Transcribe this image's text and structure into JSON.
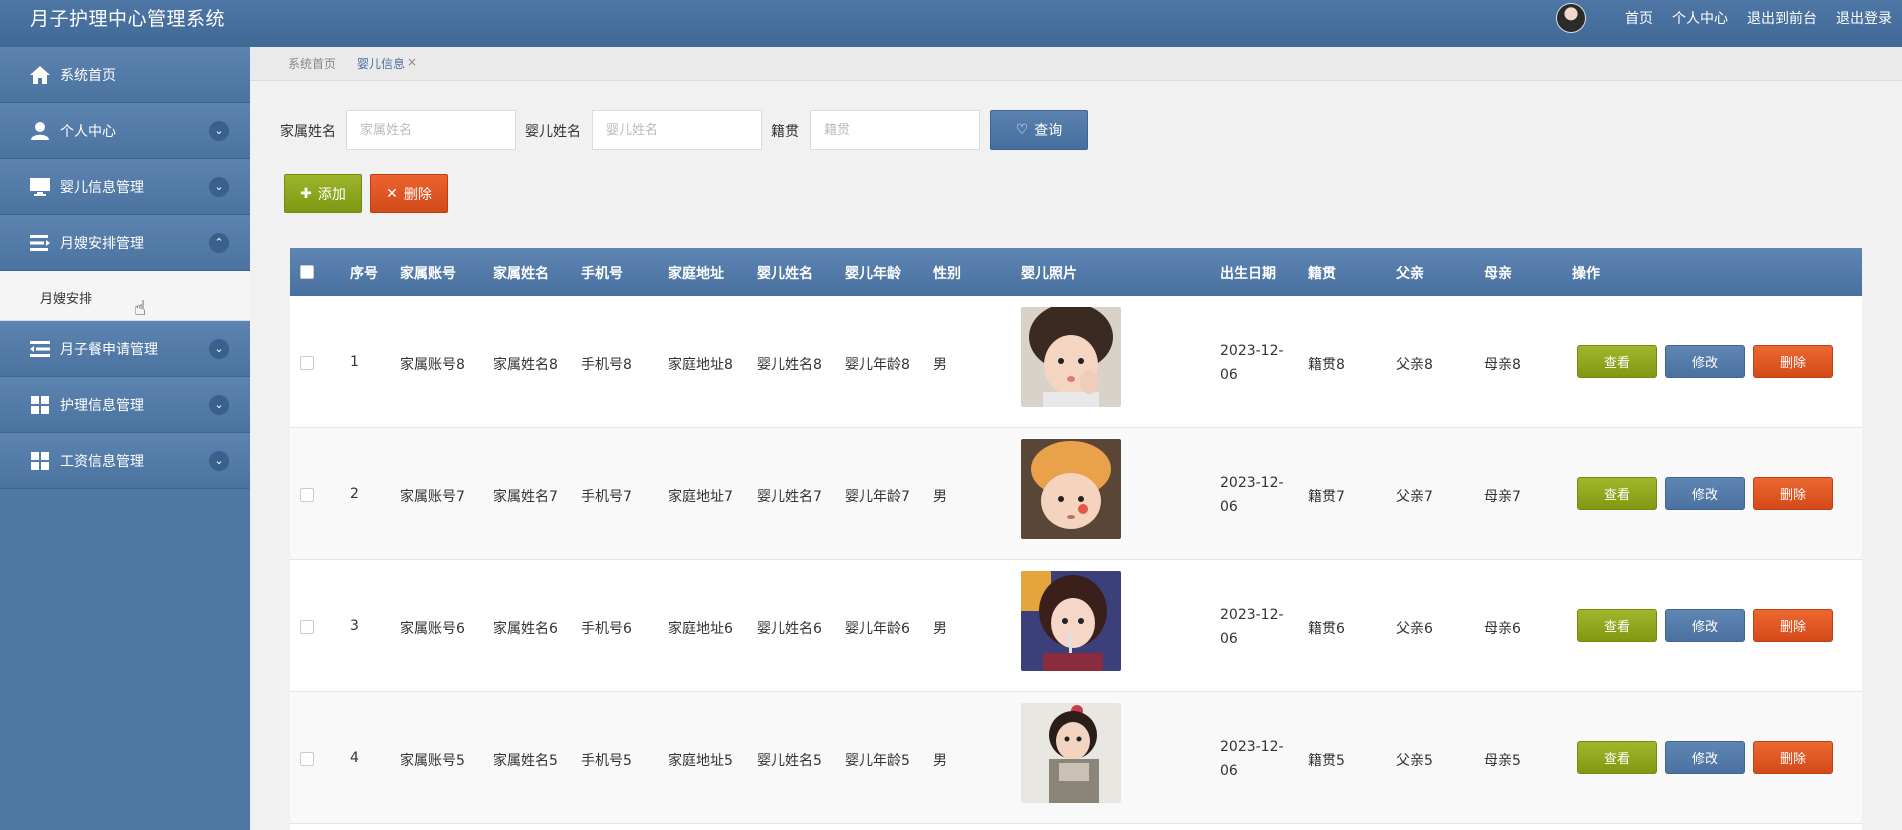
{
  "header": {
    "title": "月子护理中心管理系统",
    "links": [
      "首页",
      "个人中心",
      "退出到前台",
      "退出登录"
    ]
  },
  "sidebar": {
    "items": [
      {
        "label": "系统首页",
        "icon": "home-icon",
        "arrow": ""
      },
      {
        "label": "个人中心",
        "icon": "user-icon",
        "arrow": "⌄"
      },
      {
        "label": "婴儿信息管理",
        "icon": "monitor-icon",
        "arrow": "⌄"
      },
      {
        "label": "月嫂安排管理",
        "icon": "list-icon",
        "arrow": "⌃"
      },
      {
        "label": "月子餐申请管理",
        "icon": "list-icon",
        "arrow": "⌄"
      },
      {
        "label": "护理信息管理",
        "icon": "grid-icon",
        "arrow": "⌄"
      },
      {
        "label": "工资信息管理",
        "icon": "grid-icon",
        "arrow": "⌄"
      }
    ],
    "submenu": "月嫂安排"
  },
  "breadcrumb": {
    "home": "系统首页",
    "current": "婴儿信息",
    "close": "×"
  },
  "search": {
    "labels": [
      "家属姓名",
      "婴儿姓名",
      "籍贯"
    ],
    "placeholders": [
      "家属姓名",
      "婴儿姓名",
      "籍贯"
    ],
    "query_label": "查询",
    "add_label": "添加",
    "delete_label": "删除"
  },
  "table": {
    "headers": [
      "序号",
      "家属账号",
      "家属姓名",
      "手机号",
      "家庭地址",
      "婴儿姓名",
      "婴儿年龄",
      "性别",
      "婴儿照片",
      "出生日期",
      "籍贯",
      "父亲",
      "母亲",
      "操作"
    ],
    "rows": [
      {
        "no": "1",
        "account": "家属账号8",
        "name": "家属姓名8",
        "phone": "手机号8",
        "address": "家庭地址8",
        "baby": "婴儿姓名8",
        "age": "婴儿年龄8",
        "gender": "男",
        "date": "2023-12-06",
        "origin": "籍贯8",
        "father": "父亲8",
        "mother": "母亲8"
      },
      {
        "no": "2",
        "account": "家属账号7",
        "name": "家属姓名7",
        "phone": "手机号7",
        "address": "家庭地址7",
        "baby": "婴儿姓名7",
        "age": "婴儿年龄7",
        "gender": "男",
        "date": "2023-12-06",
        "origin": "籍贯7",
        "father": "父亲7",
        "mother": "母亲7"
      },
      {
        "no": "3",
        "account": "家属账号6",
        "name": "家属姓名6",
        "phone": "手机号6",
        "address": "家庭地址6",
        "baby": "婴儿姓名6",
        "age": "婴儿年龄6",
        "gender": "男",
        "date": "2023-12-06",
        "origin": "籍贯6",
        "father": "父亲6",
        "mother": "母亲6"
      },
      {
        "no": "4",
        "account": "家属账号5",
        "name": "家属姓名5",
        "phone": "手机号5",
        "address": "家庭地址5",
        "baby": "婴儿姓名5",
        "age": "婴儿年龄5",
        "gender": "男",
        "date": "2023-12-06",
        "origin": "籍贯5",
        "father": "父亲5",
        "mother": "母亲5"
      }
    ],
    "actions": {
      "view": "查看",
      "edit": "修改",
      "delete": "删除"
    }
  },
  "colors": {
    "primary": "#4a71a0",
    "green": "#8aa31a",
    "red": "#e05420"
  }
}
